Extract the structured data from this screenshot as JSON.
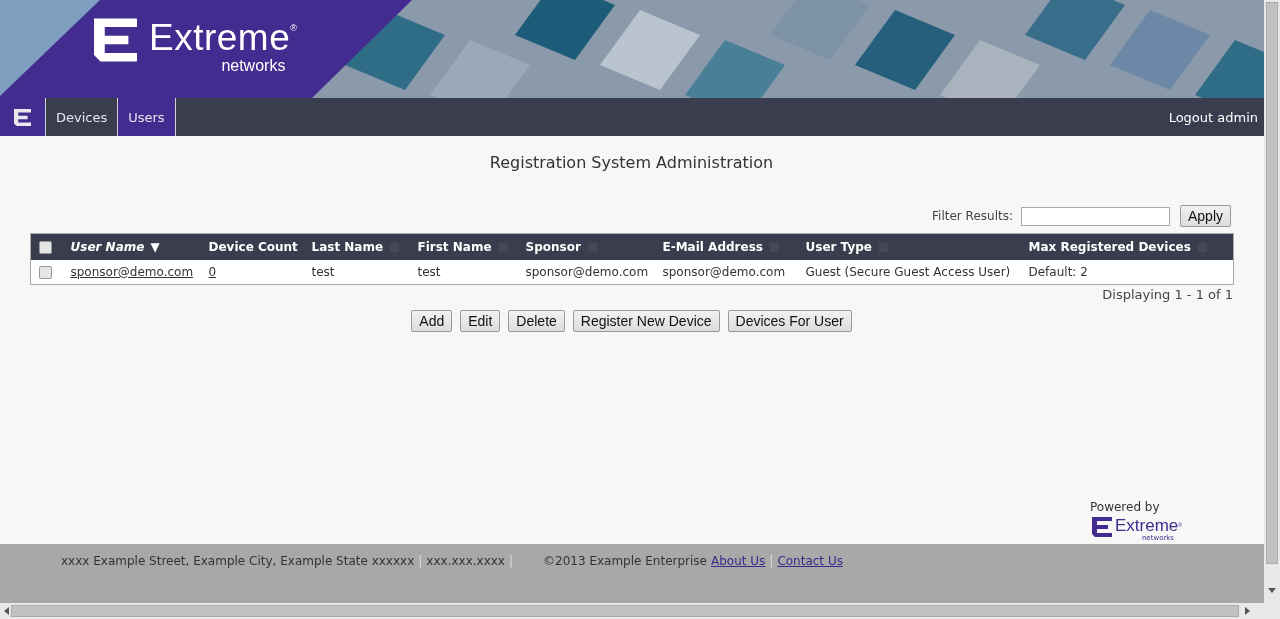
{
  "brand": {
    "name": "Extreme",
    "sub": "networks",
    "mark": "®"
  },
  "nav": {
    "tabs": [
      {
        "label": "Devices",
        "selected": false
      },
      {
        "label": "Users",
        "selected": true
      }
    ],
    "logout": "Logout admin"
  },
  "title": "Registration System Administration",
  "filter": {
    "label": "Filter Results:",
    "button": "Apply"
  },
  "table": {
    "select_all": {
      "checked": false
    },
    "columns": [
      {
        "label": "User Name",
        "sorted": true,
        "sort_arrow": "▼"
      },
      {
        "label": "Device Count",
        "sorted": false,
        "sortable": false
      },
      {
        "label": "Last Name",
        "sorted": false,
        "sortable": true
      },
      {
        "label": "First Name",
        "sorted": false,
        "sortable": true
      },
      {
        "label": "Sponsor",
        "sorted": false,
        "sortable": true
      },
      {
        "label": "E-Mail Address",
        "sorted": false,
        "sortable": true
      },
      {
        "label": "User Type",
        "sorted": false,
        "sortable": true
      },
      {
        "label": "Max Registered Devices",
        "sorted": false,
        "sortable": true
      }
    ],
    "rows": [
      {
        "checked": false,
        "cells": [
          {
            "kind": "link",
            "text": "sponsor@demo.com"
          },
          {
            "kind": "link",
            "text": "0"
          },
          {
            "kind": "text",
            "text": "test"
          },
          {
            "kind": "text",
            "text": "test"
          },
          {
            "kind": "text",
            "text": "sponsor@demo.com"
          },
          {
            "kind": "text",
            "text": "sponsor@demo.com"
          },
          {
            "kind": "text",
            "text": "Guest (Secure Guest Access User)"
          },
          {
            "kind": "text",
            "text": "Default: 2"
          }
        ]
      }
    ],
    "paging": "Displaying 1 - 1 of 1"
  },
  "buttons": [
    "Add",
    "Edit",
    "Delete",
    "Register New Device",
    "Devices For User"
  ],
  "powered_by": {
    "label": "Powered by",
    "name": "Extreme",
    "sub": "networks",
    "mark": "®"
  },
  "footer": {
    "address": "xxxx Example Street, Example City, Example State xxxxxx",
    "phone": "xxx.xxx.xxxx",
    "copyright": "©2013 Example Enterprise",
    "links": [
      "About Us",
      "Contact Us"
    ],
    "separator": "|"
  }
}
